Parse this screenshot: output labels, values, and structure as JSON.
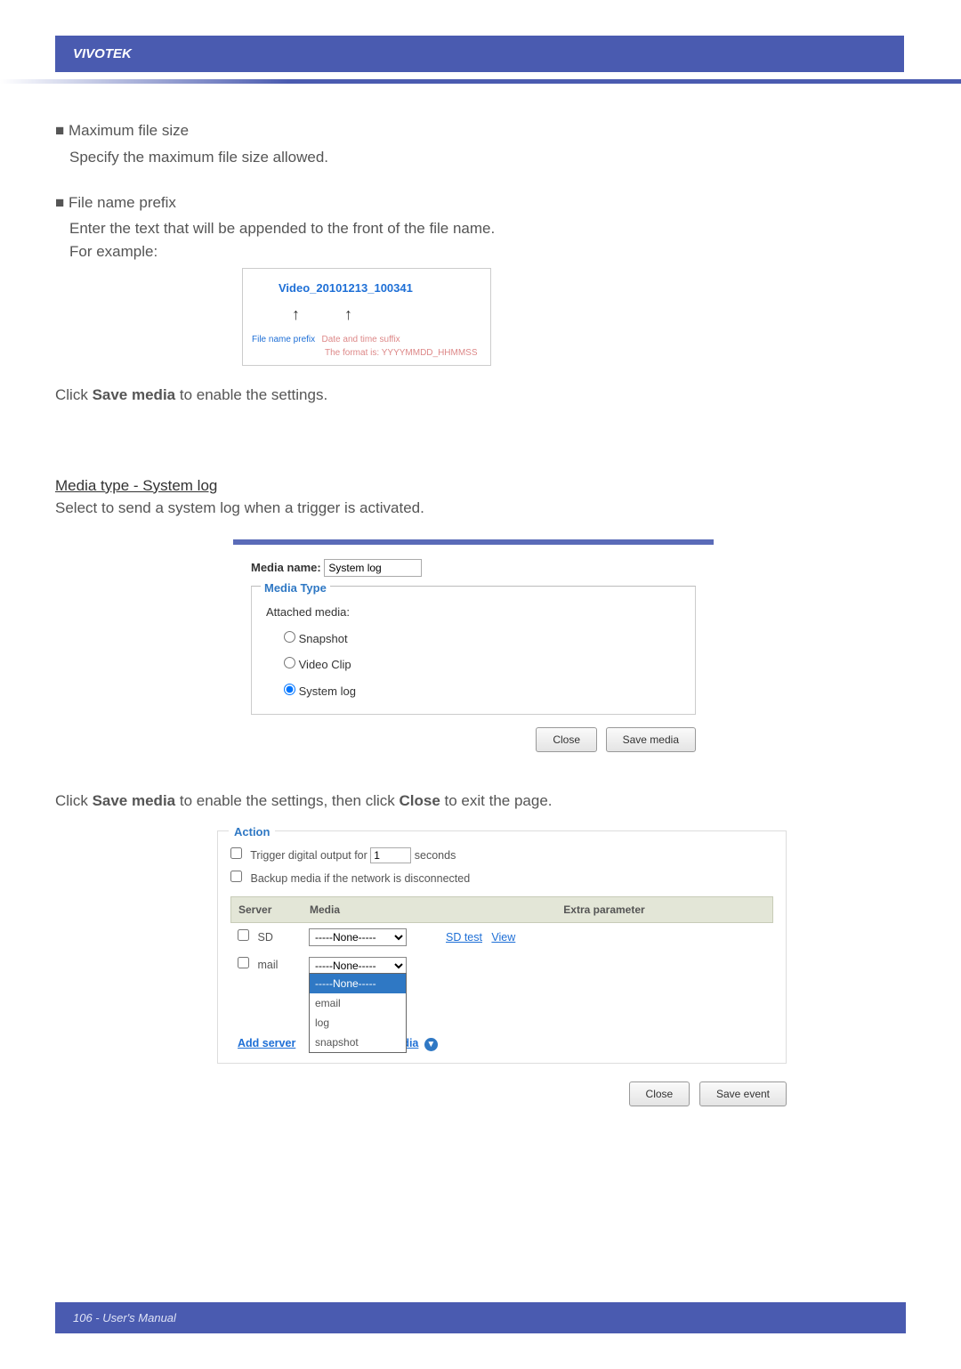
{
  "header": {
    "brand": "VIVOTEK"
  },
  "body": {
    "bullet1_title": "Maximum file size",
    "bullet1_desc": "Specify the maximum file size allowed.",
    "bullet2_title": "File name prefix",
    "bullet2_desc": "Enter the text that will be appended to the front of the file name.",
    "bullet2_desc2": "For example:",
    "example": {
      "filename": "Video_20101213_100341",
      "label_prefix": "File name prefix",
      "label_suffix": "Date and time suffix",
      "label_format": "The format is: YYYYMMDD_HHMMSS"
    },
    "save_media_line": "Click Save media to enable the settings.",
    "mediatype_h": "Media type - System log",
    "mediatype_desc": "Select to send a system log when a trigger is activated.",
    "media_panel": {
      "media_name_label": "Media name:",
      "media_name_value": "System log",
      "legend": "Media Type",
      "attached_label": "Attached media:",
      "opt_snapshot": "Snapshot",
      "opt_videoclip": "Video Clip",
      "opt_systemlog": "System log",
      "btn_close": "Close",
      "btn_save": "Save media"
    },
    "save_then_close": "Click Save media to enable the settings, then click Close to exit the page.",
    "action_panel": {
      "legend": "Action",
      "trigger_label_a": "Trigger digital output for",
      "trigger_value": "1",
      "trigger_label_b": "seconds",
      "backup_label": "Backup media if the network is disconnected",
      "hdr_server": "Server",
      "hdr_media": "Media",
      "hdr_extra": "Extra parameter",
      "row1_server": "SD",
      "row1_media": "-----None-----",
      "row1_link1": "SD test",
      "row1_link2": "View",
      "row2_server": "mail",
      "row2_media": "-----None-----",
      "add_server": "Add server",
      "dd_none": "-----None-----",
      "dd_email": "email",
      "dd_log": "log",
      "dd_snapshot": "snapshot",
      "dia_link": "dia",
      "btn_close": "Close",
      "btn_save": "Save event"
    }
  },
  "footer": {
    "text": "106 - User's Manual"
  }
}
